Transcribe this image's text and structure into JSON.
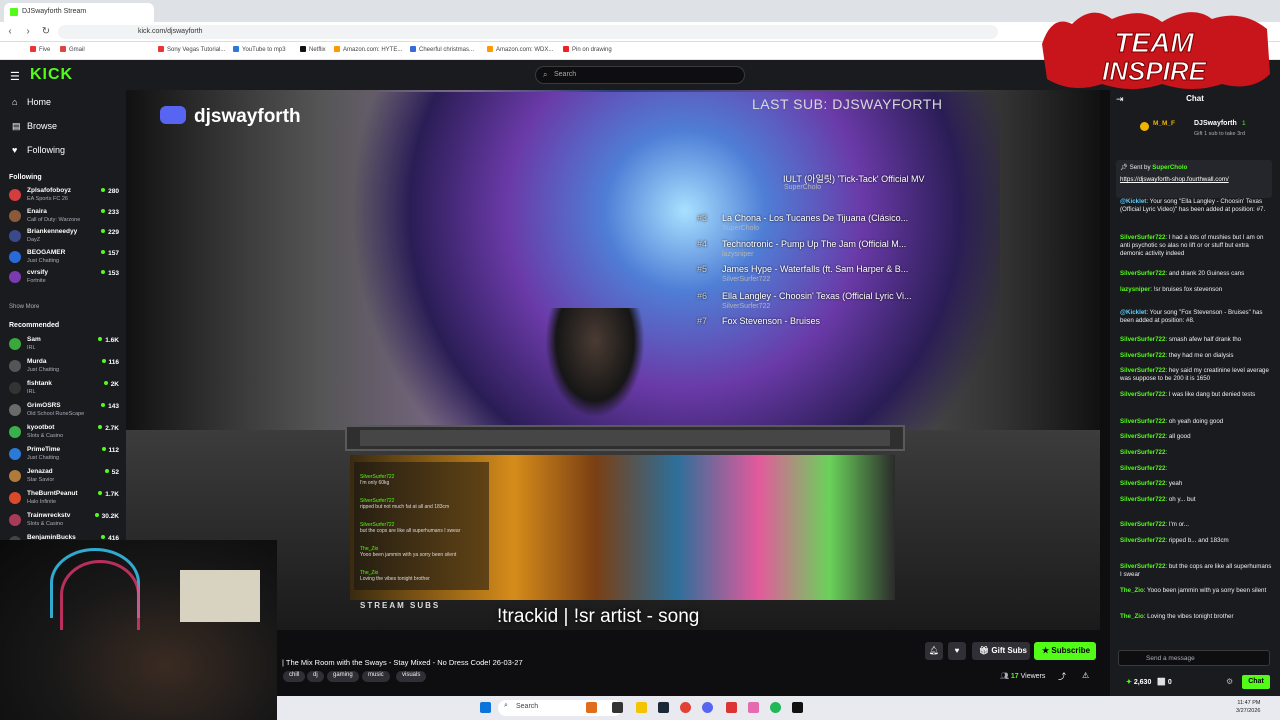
{
  "browser": {
    "tab_title": "DJSwayforth Stream",
    "url": "kick.com/djswayforth",
    "bookmarks": [
      "Five",
      "Gmail",
      "Sony Vegas Tutorial...",
      "YouTube to mp3",
      "Netflix",
      "Amazon.com: HYTE...",
      "Cheerful christmas...",
      "Amazon.com: WDX...",
      "Pin on drawing"
    ]
  },
  "header": {
    "logo": "KICK",
    "search_placeholder": "Search"
  },
  "sidebar": {
    "nav": [
      {
        "icon": "⌂",
        "label": "Home"
      },
      {
        "icon": "▤",
        "label": "Browse"
      },
      {
        "icon": "♥",
        "label": "Following"
      }
    ],
    "following_label": "Following",
    "following": [
      {
        "name": "Zplsafofoboyz",
        "game": "EA Sports FC 26",
        "viewers": "280",
        "color": "#d23e3e"
      },
      {
        "name": "Enaira",
        "game": "Call of Duty: Warzone",
        "viewers": "233",
        "color": "#8a5a3a"
      },
      {
        "name": "Briankenneedyy",
        "game": "DayZ",
        "viewers": "229",
        "color": "#3a4a8a"
      },
      {
        "name": "BEOGAMER",
        "game": "Just Chatting",
        "viewers": "157",
        "color": "#2a6ad8"
      },
      {
        "name": "cvrsify",
        "game": "Fortnite",
        "viewers": "153",
        "color": "#7a3ab0"
      }
    ],
    "show_more": "Show More",
    "recommended_label": "Recommended",
    "recommended": [
      {
        "name": "Sam",
        "game": "IRL",
        "viewers": "1.6K",
        "color": "#3aa83a"
      },
      {
        "name": "Murda",
        "game": "Just Chatting",
        "viewers": "116",
        "color": "#555"
      },
      {
        "name": "fishtank",
        "game": "IRL",
        "viewers": "2K",
        "color": "#333"
      },
      {
        "name": "GrimOSRS",
        "game": "Old School RuneScape",
        "viewers": "143",
        "color": "#6a6a6a"
      },
      {
        "name": "kyootbot",
        "game": "Slots & Casino",
        "viewers": "2.7K",
        "color": "#3ab04a"
      },
      {
        "name": "PrimeTime",
        "game": "Just Chatting",
        "viewers": "112",
        "color": "#2a7ad8"
      },
      {
        "name": "Jenazad",
        "game": "Star Savior",
        "viewers": "52",
        "color": "#b07a3a"
      },
      {
        "name": "TheBurntPeanut",
        "game": "Halo Infinite",
        "viewers": "1.7K",
        "color": "#d84a2a"
      },
      {
        "name": "Trainwreckstv",
        "game": "Slots & Casino",
        "viewers": "30.2K",
        "color": "#a83a5a"
      },
      {
        "name": "BenjaminBucks",
        "game": "",
        "viewers": "416",
        "color": "#444"
      }
    ]
  },
  "stream": {
    "discord": "djswayforth",
    "last_sub": "LAST SUB: DJSWAYFORTH",
    "queue": [
      {
        "n": "",
        "song": "IULT (아일릿) 'Tick-Tack' Official MV",
        "req": "SuperCholo"
      },
      {
        "n": "#3",
        "song": "La Chona - Los Tucanes De Tijuana (Clásico...",
        "req": "SuperCholo"
      },
      {
        "n": "#4",
        "song": "Technotronic - Pump Up The Jam (Official M...",
        "req": "lazysniper"
      },
      {
        "n": "#5",
        "song": "James Hype - Waterfalls (ft. Sam Harper & B...",
        "req": "SilverSurfer722"
      },
      {
        "n": "#6",
        "song": "Ella Langley - Choosin' Texas (Official Lyric Vi...",
        "req": "SilverSurfer722"
      },
      {
        "n": "#7",
        "song": "Fox Stevenson - Bruises",
        "req": ""
      }
    ],
    "overlay_chat": [
      {
        "u": "SilverSurfer722",
        "t": "I'm only 60kg"
      },
      {
        "u": "SilverSurfer722",
        "t": "ripped but not much fat at all and 183cm"
      },
      {
        "u": "SilverSurfer722",
        "t": "but the cops are like all superhumans I swear"
      },
      {
        "u": "The_Zio",
        "t": "Yooo been jammin with ya sorry been silent"
      },
      {
        "u": "The_Zio",
        "t": "Loving the vibes tonight brother"
      }
    ],
    "stream_subs": "STREAM SUBS",
    "trackid": "!trackid | !sr artist - song",
    "title": "| The Mix Room with the Sways - Stay Mixed - No Dress Code! 26-03-27",
    "tags": [
      "chill",
      "dj",
      "gaming",
      "music",
      "visuals"
    ],
    "viewers": "17",
    "viewers_label": "Viewers",
    "gift_subs": "Gift Subs",
    "subscribe": "Subscribe"
  },
  "chat": {
    "header": "Chat",
    "top_gifter": {
      "rank": "M_M_F",
      "name": "DJSwayforth",
      "count": "1",
      "note": "Gift 1 sub to take 3rd"
    },
    "pinned_by": "Sent by",
    "pinned_user": "SuperCholo",
    "pinned_link": "https://djswayforth-shop.fourthwall.com/",
    "messages": [
      {
        "u": "@Kicklet",
        "t": ": Your song \"Ella Langley - Choosin' Texas (Official Lyric Video)\" has been added at position: #7."
      },
      {
        "u": "SilverSurfer722",
        "t": ": I had a lots of mushies but I am on anti psychotic so alas no lift or or stuff but extra demonic activity indeed"
      },
      {
        "u": "SilverSurfer722",
        "t": ": and drank 20 Guiness cans"
      },
      {
        "u": "lazysniper",
        "t": ": !sr bruises fox stevenson"
      },
      {
        "u": "@Kicklet",
        "t": ": Your song \"Fox Stevenson - Bruises\" has been added at position: #8."
      },
      {
        "u": "SilverSurfer722",
        "t": ": smash afew half drank tho"
      },
      {
        "u": "SilverSurfer722",
        "t": ": they had me on dialysis"
      },
      {
        "u": "SilverSurfer722",
        "t": ": hey said my creatinine level average was suppose to be 200 it is 1650"
      },
      {
        "u": "SilverSurfer722",
        "t": ": I was like dang but denied tests"
      },
      {
        "u": "SilverSurfer722",
        "t": ": oh yeah doing good"
      },
      {
        "u": "SilverSurfer722",
        "t": ": all good"
      },
      {
        "u": "SilverSurfer722",
        "t": ":"
      },
      {
        "u": "SilverSurfer722",
        "t": ":"
      },
      {
        "u": "SilverSurfer722",
        "t": ": yeah"
      },
      {
        "u": "SilverSurfer722",
        "t": ": oh y... but"
      },
      {
        "u": "SilverSurfer722",
        "t": ": I'm or..."
      },
      {
        "u": "SilverSurfer722",
        "t": ": ripped b... and 183cm"
      },
      {
        "u": "SilverSurfer722",
        "t": ": but the cops are like all superhumans I swear"
      },
      {
        "u": "The_Zio",
        "t": ": Yooo been jammin with ya sorry been silent"
      },
      {
        "u": "The_Zio",
        "t": ": Loving the vibes tonight brother"
      }
    ],
    "send_placeholder": "Send a message",
    "points": "2,630",
    "zero": "0",
    "chat_button": "Chat"
  },
  "taskbar": {
    "search": "Search",
    "time": "11:47 PM",
    "date": "3/27/2026"
  },
  "logo_text": "TEAM INSPIRE",
  "colors": {
    "accent": "#53fc18",
    "bg": "#0e0e10",
    "panel": "#191b1f"
  }
}
